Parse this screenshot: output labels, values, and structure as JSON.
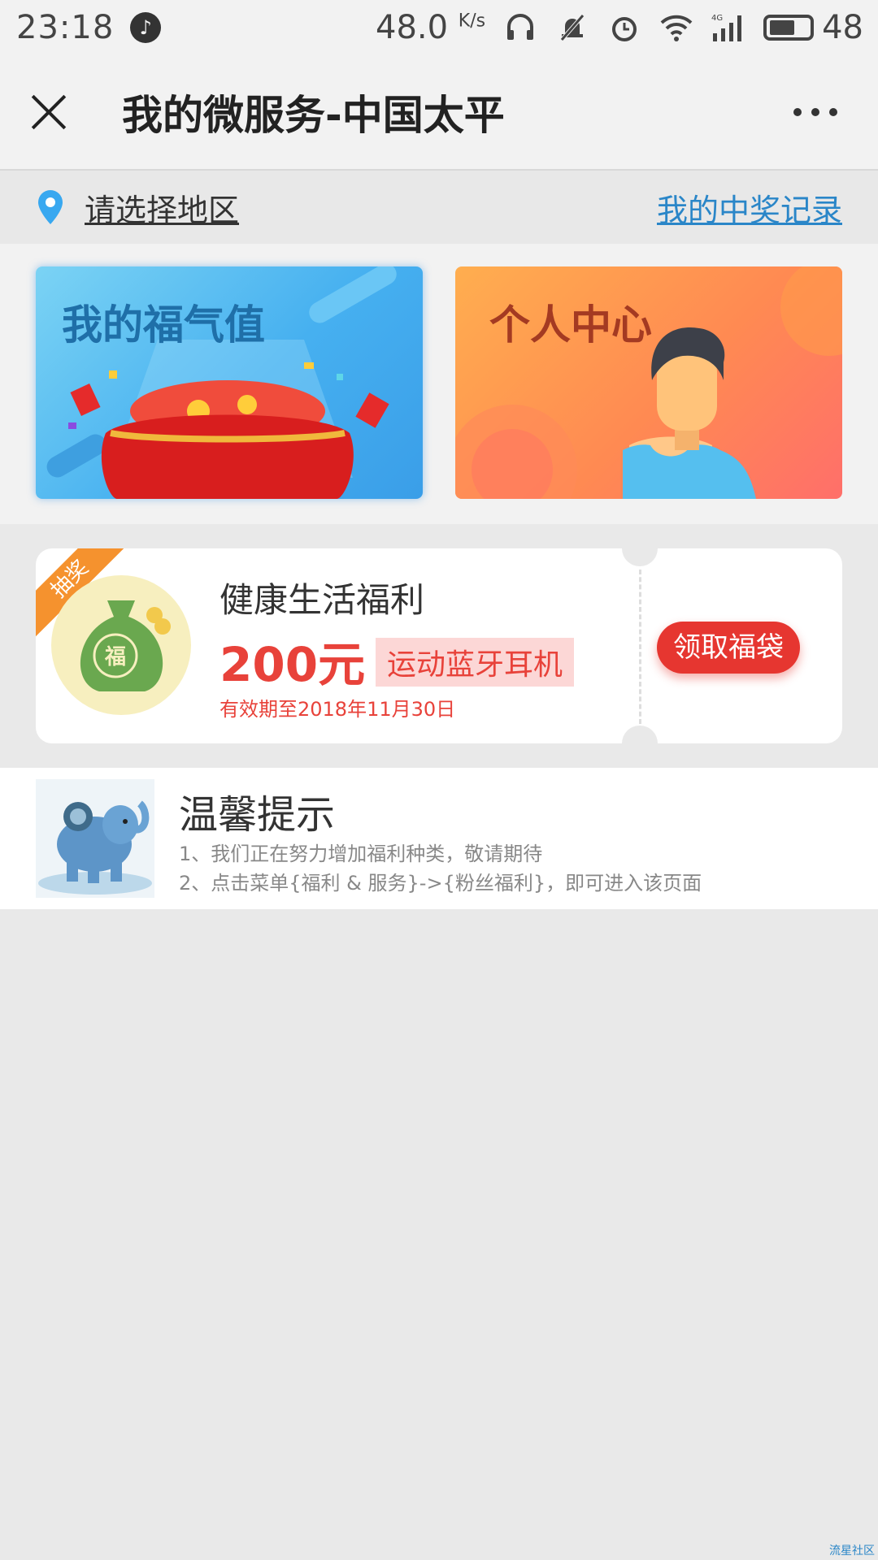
{
  "status_bar": {
    "time": "23:18",
    "net_speed": "48.0",
    "net_unit": "K/s",
    "battery": "48"
  },
  "app_bar": {
    "title": "我的微服务-中国太平"
  },
  "location": {
    "label": "请选择地区",
    "prize_link": "我的中奖记录"
  },
  "banners": [
    {
      "title": "我的福气值"
    },
    {
      "title": "个人中心"
    }
  ],
  "coupon": {
    "ribbon": "抽奖",
    "bag_char": "福",
    "title": "健康生活福利",
    "amount": "200元",
    "tag": "运动蓝牙耳机",
    "valid": "有效期至2018年11月30日",
    "button": "领取福袋"
  },
  "tips": {
    "title": "温馨提示",
    "line1": "1、我们正在努力增加福利种类，敬请期待",
    "line2": "2、点击菜单{福利 & 服务}->{粉丝福利}，即可进入该页面"
  },
  "watermark": "流星社区",
  "colors": {
    "accent_red": "#e63630",
    "link_blue": "#2a86c8",
    "ribbon_orange": "#f5922e"
  }
}
